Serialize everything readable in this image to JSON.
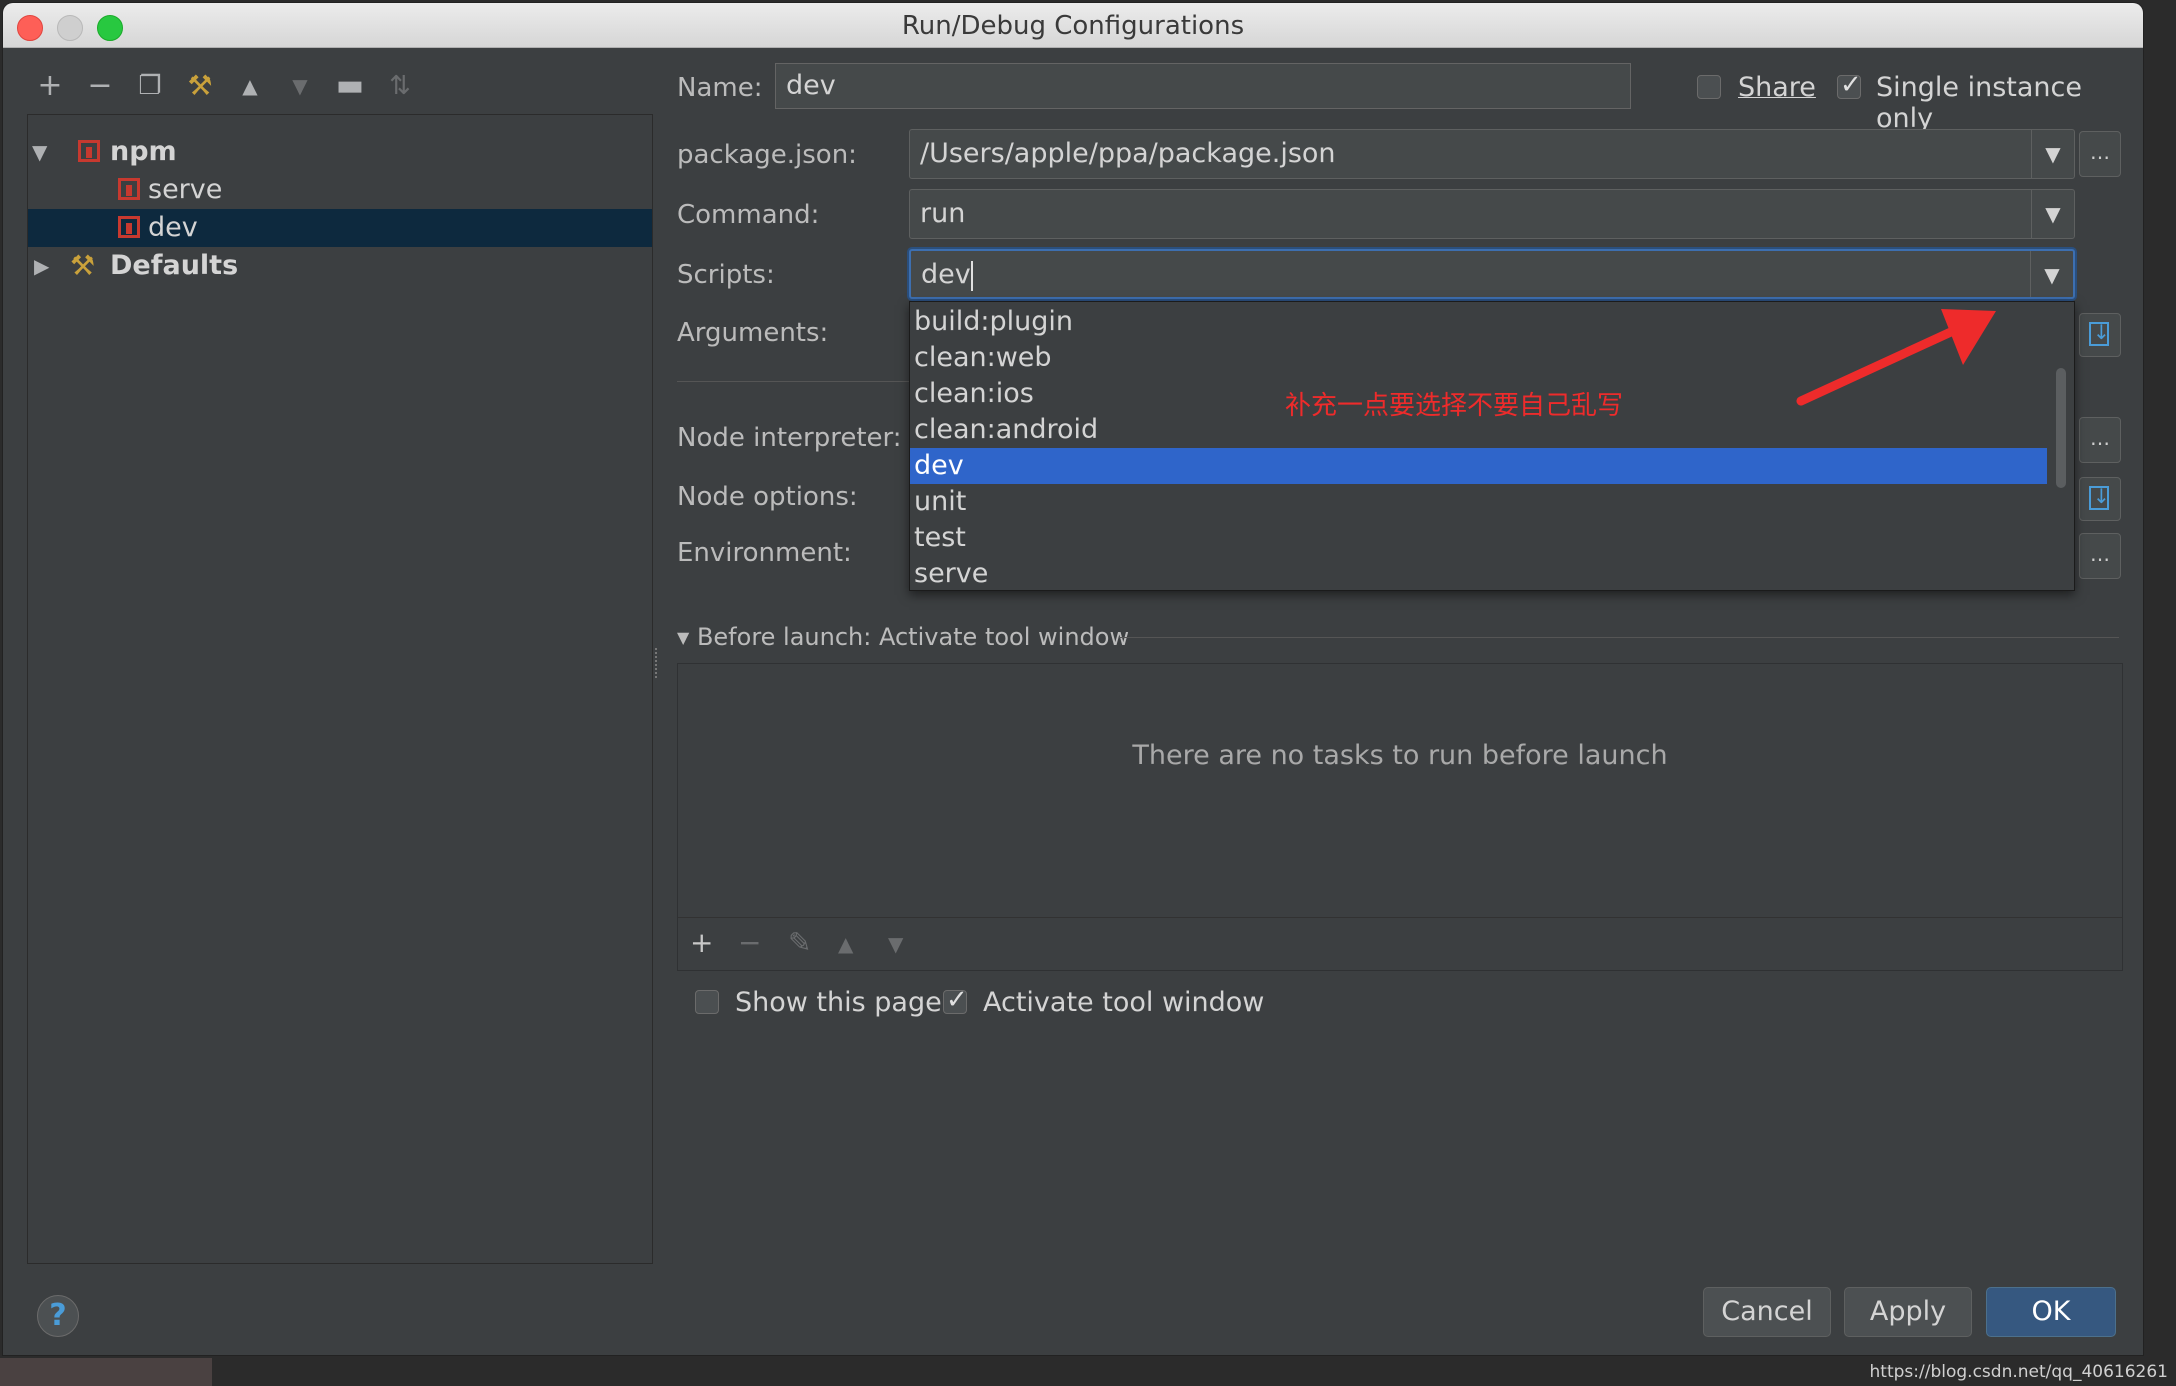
{
  "window": {
    "title": "Run/Debug Configurations"
  },
  "toolbar": {
    "icons": [
      "add-icon",
      "remove-icon",
      "copy-icon",
      "wrench-icon",
      "move-up-icon",
      "move-down-icon",
      "folder-icon",
      "sort-icon"
    ]
  },
  "tree": {
    "npm_label": "npm",
    "items": [
      {
        "label": "serve"
      },
      {
        "label": "dev"
      }
    ],
    "defaults_label": "Defaults"
  },
  "form": {
    "name_label": "Name:",
    "name_value": "dev",
    "share_label": "Share",
    "share_checked": false,
    "single_instance_label": "Single instance only",
    "single_instance_checked": true,
    "package_label": "package.json:",
    "package_value": "/Users/apple/ppa/package.json",
    "command_label": "Command:",
    "command_value": "run",
    "scripts_label": "Scripts:",
    "scripts_value": "dev",
    "arguments_label": "Arguments:",
    "node_interpreter_label": "Node interpreter:",
    "node_options_label": "Node options:",
    "environment_label": "Environment:"
  },
  "scripts_dropdown": {
    "items": [
      "build:plugin",
      "clean:web",
      "clean:ios",
      "clean:android",
      "dev",
      "unit",
      "test",
      "serve"
    ],
    "selected": "dev"
  },
  "annotation": {
    "text": "补充一点要选择不要自己乱写",
    "color": "#ee2b2b"
  },
  "before_launch": {
    "title": "Before launch: Activate tool window",
    "empty_text": "There are no tasks to run before launch",
    "show_page_label": "Show this page",
    "show_page_checked": false,
    "activate_label": "Activate tool window",
    "activate_checked": true
  },
  "buttons": {
    "cancel": "Cancel",
    "apply": "Apply",
    "ok": "OK"
  },
  "help": {
    "symbol": "?"
  },
  "watermark": "https://blog.csdn.net/qq_40616261",
  "colors": {
    "selection": "#2f65ca",
    "tree_selection": "#0d293e",
    "accent": "#4a9cd8"
  }
}
